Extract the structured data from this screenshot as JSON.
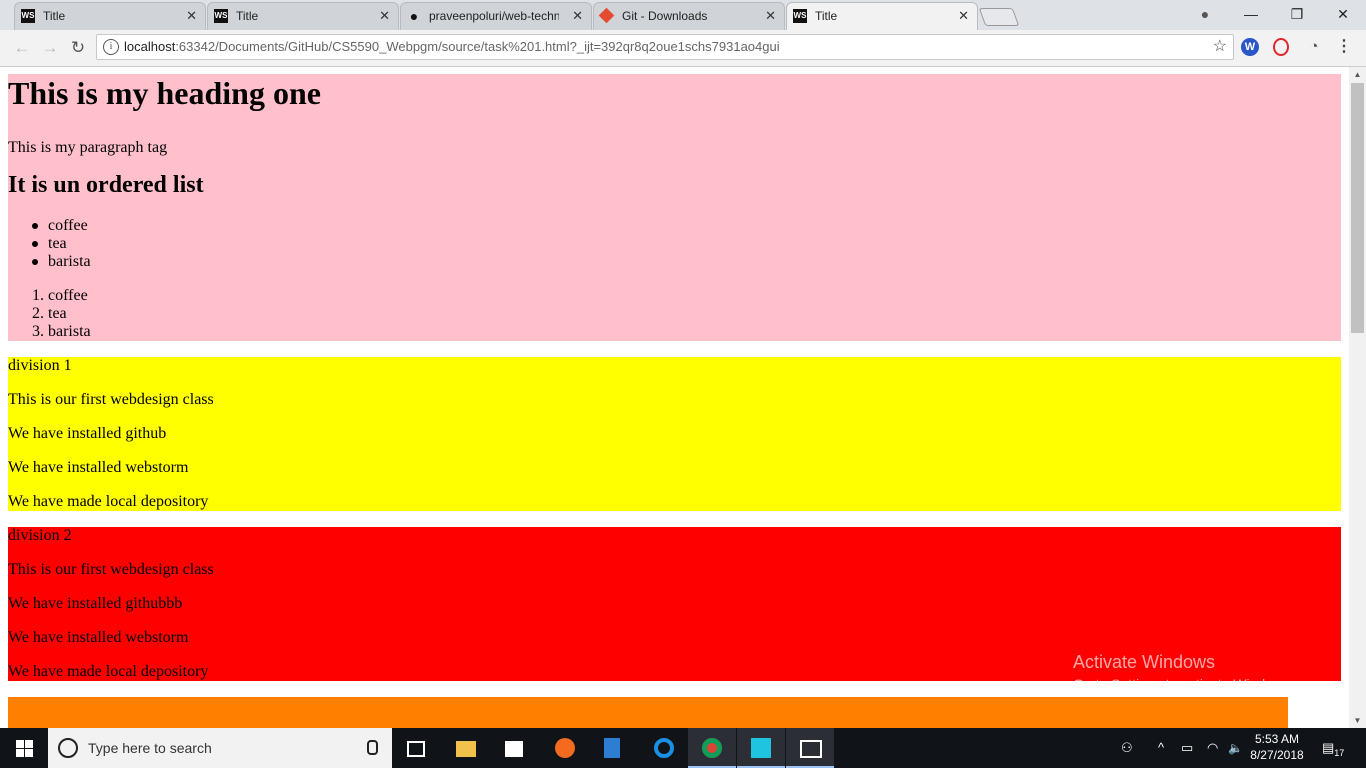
{
  "browser": {
    "tabs": [
      {
        "favicon": "webstorm-icon",
        "title": "Title",
        "active": false
      },
      {
        "favicon": "webstorm-icon",
        "title": "Title",
        "active": false
      },
      {
        "favicon": "github-icon",
        "title": "praveenpoluri/web-techn",
        "active": false
      },
      {
        "favicon": "git-icon",
        "title": "Git - Downloads",
        "active": false
      },
      {
        "favicon": "webstorm-icon",
        "title": "Title",
        "active": true
      }
    ],
    "favicon_text": "WS",
    "close_glyph": "✕",
    "window_controls": {
      "minimize": "—",
      "restore": "❐",
      "close": "✕",
      "profile": "●"
    },
    "nav": {
      "back": "←",
      "forward": "→",
      "reload": "↻"
    },
    "url_host": "localhost",
    "url_rest": ":63342/Documents/GitHub/CS5590_Webpgm/source/task%201.html?_ijt=392qr8q2oue1schs7931ao4gui",
    "star": "☆",
    "info": "i",
    "extensions": [
      {
        "name": "w-extension-icon",
        "glyph": "W",
        "color": "#2b56c8"
      },
      {
        "name": "opera-icon",
        "glyph": "O",
        "color": "#e0262d"
      },
      {
        "name": "speed-icon",
        "glyph": "◔",
        "color": "#555555"
      },
      {
        "name": "menu-icon",
        "glyph": "⋮",
        "color": "#444444"
      }
    ]
  },
  "page": {
    "heading_one": "This is my heading one",
    "paragraph": "This is my paragraph tag",
    "list_heading": "It is un ordered list",
    "unordered": [
      "coffee",
      "tea",
      "barista"
    ],
    "ordered": [
      "coffee",
      "tea",
      "barista"
    ],
    "ordered_numbers": [
      "1.",
      "2.",
      "3."
    ],
    "division1": {
      "color": "#ffff00",
      "lines": [
        "division 1",
        "This is our first webdesign class",
        "We have installed github",
        "We have installed webstorm",
        "We have made local depository"
      ]
    },
    "division2": {
      "color": "#ff0000",
      "lines": [
        "division 2",
        "This is our first webdesign class",
        "We have installed githubbb",
        "We have installed webstorm",
        "We have made local depository"
      ]
    },
    "colors": {
      "pink": "#ffc0cb",
      "orange": "#ff8000"
    }
  },
  "watermark": {
    "line1": "Activate Windows",
    "line2": "Go to Settings to activate Windows."
  },
  "taskbar": {
    "search_placeholder": "Type here to search",
    "apps": [
      "task-view-icon",
      "file-explorer-icon",
      "store-icon",
      "firefox-icon",
      "photos-icon",
      "edge-icon",
      "chrome-icon",
      "webstorm-icon",
      "image-viewer-icon"
    ],
    "time": "5:53 AM",
    "date": "8/27/2018",
    "notifications": "17",
    "tray": {
      "people": "⚇",
      "chevron": "^",
      "battery": "▭",
      "wifi": "◠",
      "volume": "🔈"
    }
  }
}
